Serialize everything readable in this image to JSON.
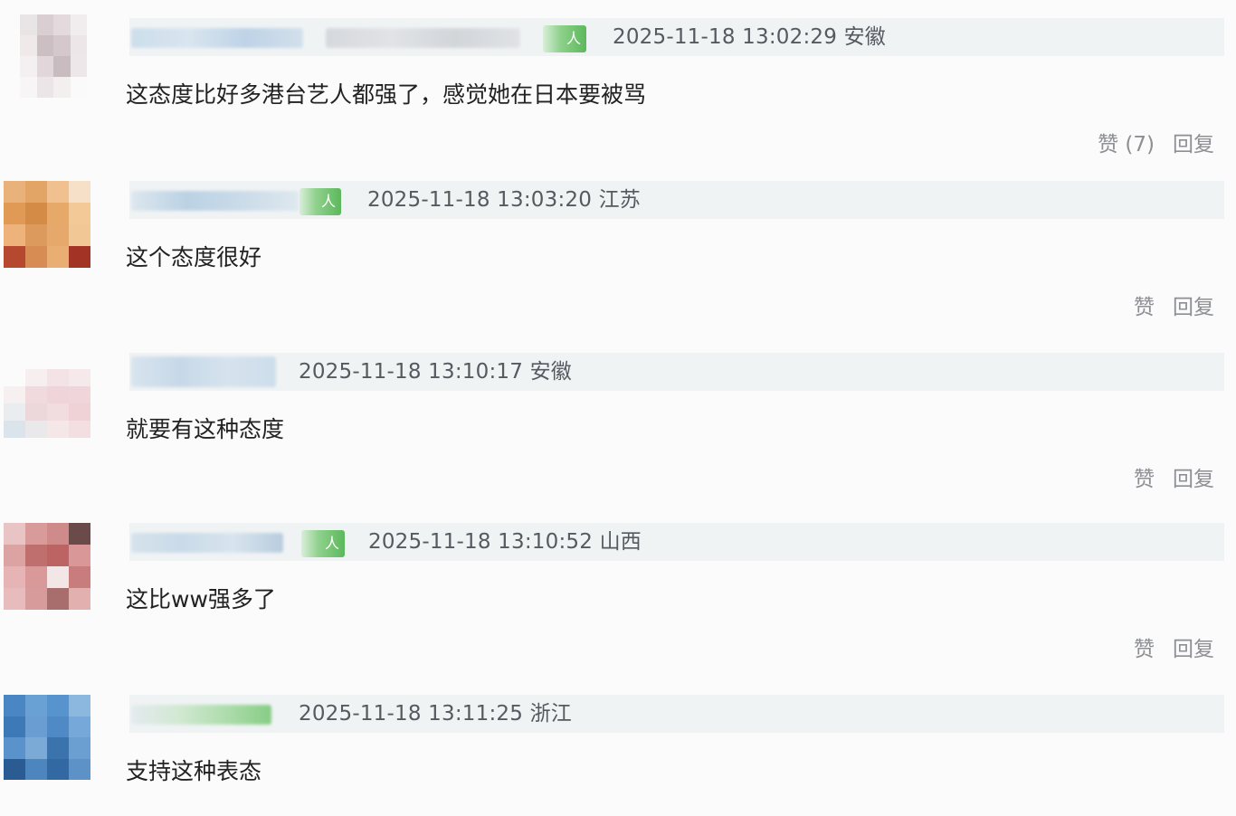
{
  "colors": {
    "background": "#fbfbfc",
    "meta_bar": "#f0f3f4",
    "meta_text": "#555a60",
    "body_text": "#222222",
    "action_text": "#8d8f93",
    "badge_green": "#5cb85c"
  },
  "comments": [
    {
      "badge": "人",
      "timestamp": "2025-11-18 13:02:29",
      "location": "安徽",
      "text": "这态度比好多港台艺人都强了，感觉她在日本要被骂",
      "like_label": "赞 (7)",
      "reply_label": "回复"
    },
    {
      "badge": "人",
      "timestamp": "2025-11-18 13:03:20",
      "location": "江苏",
      "text": "这个态度很好",
      "like_label": "赞",
      "reply_label": "回复"
    },
    {
      "badge": "",
      "timestamp": "2025-11-18 13:10:17",
      "location": "安徽",
      "text": "就要有这种态度",
      "like_label": "赞",
      "reply_label": "回复"
    },
    {
      "badge": "人",
      "timestamp": "2025-11-18 13:10:52",
      "location": "山西",
      "text": "这比ww强多了",
      "like_label": "赞",
      "reply_label": "回复"
    },
    {
      "badge": "",
      "timestamp": "2025-11-18 13:11:25",
      "location": "浙江",
      "text": "支持这种表态",
      "like_label": "",
      "reply_label": ""
    }
  ]
}
